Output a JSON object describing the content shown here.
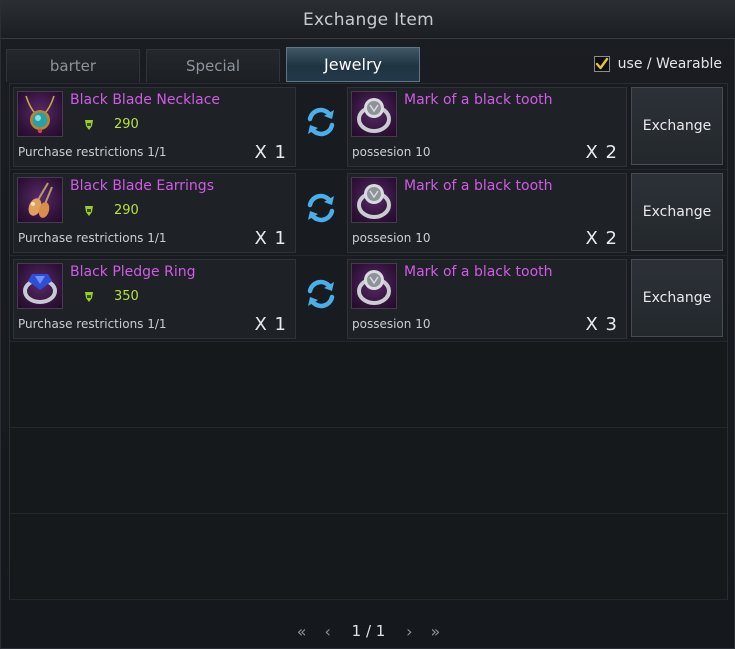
{
  "window": {
    "title": "Exchange Item"
  },
  "tabs": [
    {
      "label": "barter",
      "active": false
    },
    {
      "label": "Special",
      "active": false
    },
    {
      "label": "Jewelry",
      "active": true
    }
  ],
  "filter": {
    "label": "use / Wearable",
    "checked": true
  },
  "rows": [
    {
      "item_name": "Black Blade Necklace",
      "item_icon": "necklace-icon",
      "price": "290",
      "restriction": "Purchase restrictions 1/1",
      "quantity": "X 1",
      "cost_name": "Mark of a black tooth",
      "cost_icon": "ring-icon",
      "possession": "possesion 10",
      "cost_quantity": "X 2",
      "button": "Exchange"
    },
    {
      "item_name": "Black Blade Earrings",
      "item_icon": "earrings-icon",
      "price": "290",
      "restriction": "Purchase restrictions 1/1",
      "quantity": "X 1",
      "cost_name": "Mark of a black tooth",
      "cost_icon": "ring-icon",
      "possession": "possesion 10",
      "cost_quantity": "X 2",
      "button": "Exchange"
    },
    {
      "item_name": "Black Pledge Ring",
      "item_icon": "sapphire-ring-icon",
      "price": "350",
      "restriction": "Purchase restrictions 1/1",
      "quantity": "X 1",
      "cost_name": "Mark of a black tooth",
      "cost_icon": "ring-icon",
      "possession": "possesion 10",
      "cost_quantity": "X 3",
      "button": "Exchange"
    }
  ],
  "pagination": {
    "text": "1 / 1"
  },
  "colors": {
    "item_name": "#d15ae6",
    "price": "#b8e23d",
    "active_tab": "#2a4556"
  }
}
